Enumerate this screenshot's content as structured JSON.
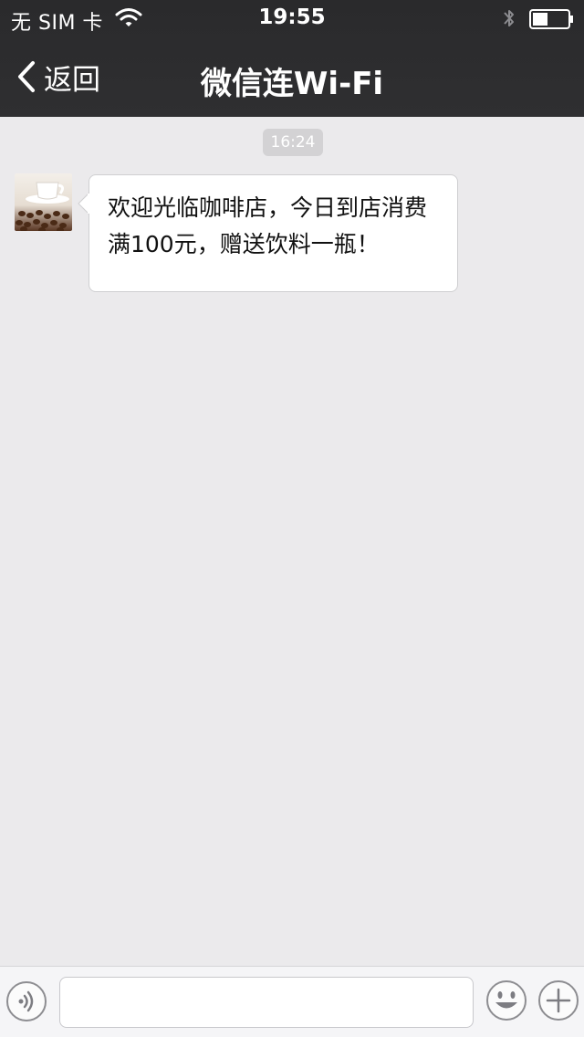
{
  "status_bar": {
    "carrier": "无 SIM 卡",
    "time": "19:55",
    "icons": [
      "wifi-icon",
      "bluetooth-icon",
      "battery-icon"
    ]
  },
  "nav": {
    "back_label": "返回",
    "title": "微信连Wi-Fi"
  },
  "chat": {
    "timestamp": "16:24",
    "messages": [
      {
        "sender_avatar": "coffee-cup-avatar",
        "text": "欢迎光临咖啡店，今日到店消费满100元，赠送饮料一瓶！"
      }
    ]
  },
  "input_bar": {
    "value": "",
    "icons": [
      "voice-icon",
      "emoji-icon",
      "plus-icon"
    ]
  },
  "colors": {
    "topbar": "#2d2d2f",
    "chat_background": "#ebeaec",
    "bubble": "#ffffff",
    "timestamp_pill": "#d3d2d4"
  }
}
